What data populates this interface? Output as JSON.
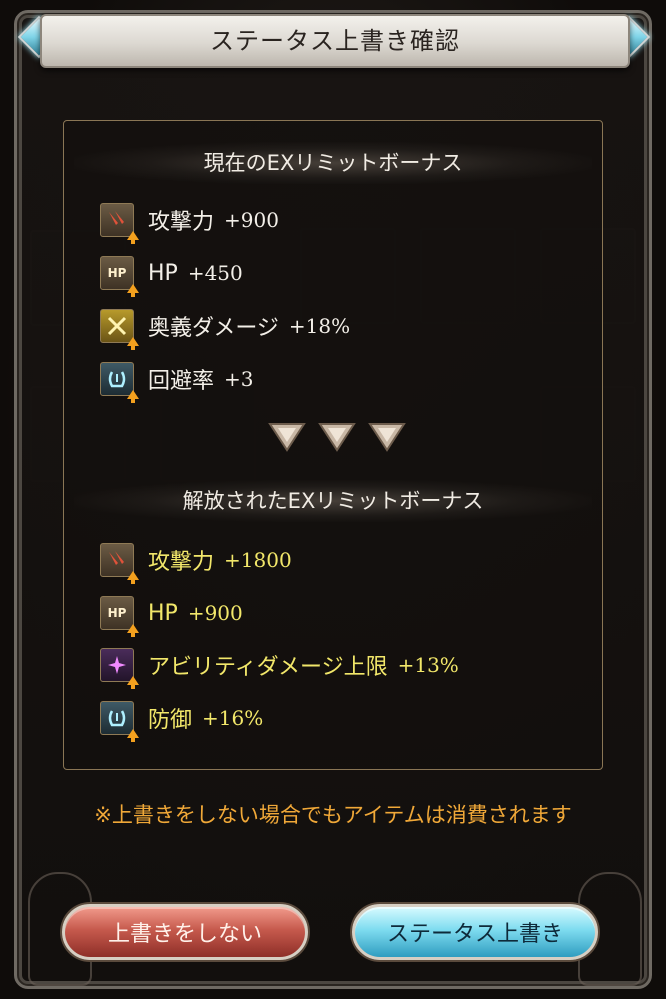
{
  "dialog": {
    "title": "ステータス上書き確認"
  },
  "current": {
    "heading": "現在のEXリミットボーナス",
    "items": [
      {
        "icon": "attack-icon",
        "label": "攻撃力",
        "value": "+900"
      },
      {
        "icon": "hp-icon",
        "icon_text": "HP",
        "label": "HP",
        "value": "+450"
      },
      {
        "icon": "ougi-damage-icon",
        "label": "奥義ダメージ",
        "value": "+18%"
      },
      {
        "icon": "evasion-icon",
        "label": "回避率",
        "value": "+3"
      }
    ]
  },
  "unlocked": {
    "heading": "解放されたEXリミットボーナス",
    "items": [
      {
        "icon": "attack-icon",
        "label": "攻撃力",
        "value": "+1800"
      },
      {
        "icon": "hp-icon",
        "icon_text": "HP",
        "label": "HP",
        "value": "+900"
      },
      {
        "icon": "ability-damage-cap-icon",
        "label": "アビリティダメージ上限",
        "value": "+13%"
      },
      {
        "icon": "defense-icon",
        "label": "防御",
        "value": "+16%"
      }
    ]
  },
  "notice": "※上書きをしない場合でもアイテムは消費されます",
  "buttons": {
    "cancel_label": "上書きをしない",
    "confirm_label": "ステータス上書き"
  },
  "colors": {
    "current_text": "#f3efe8",
    "unlocked_text": "#f2e76a",
    "notice": "#f0a838",
    "cancel_button": "#c65a4d",
    "confirm_button": "#7fdcf0"
  }
}
